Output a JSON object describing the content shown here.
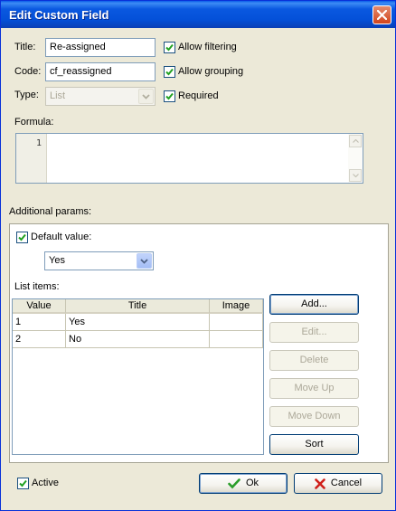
{
  "window": {
    "title": "Edit Custom Field"
  },
  "form": {
    "title_label": "Title:",
    "title_value": "Re-assigned",
    "code_label": "Code:",
    "code_value": "cf_reassigned",
    "type_label": "Type:",
    "type_value": "List",
    "allow_filtering_label": "Allow filtering",
    "allow_filtering_checked": true,
    "allow_grouping_label": "Allow grouping",
    "allow_grouping_checked": true,
    "required_label": "Required",
    "required_checked": true,
    "formula_label": "Formula:",
    "formula_line_number": "1"
  },
  "params": {
    "label": "Additional params:",
    "default_value_label": "Default value:",
    "default_value_checked": true,
    "default_value_selected": "Yes",
    "list_items_label": "List items:",
    "columns": [
      "Value",
      "Title",
      "Image"
    ],
    "rows": [
      {
        "value": "1",
        "title": "Yes",
        "image": ""
      },
      {
        "value": "2",
        "title": "No",
        "image": ""
      }
    ],
    "buttons": {
      "add": "Add...",
      "edit": "Edit...",
      "delete": "Delete",
      "move_up": "Move Up",
      "move_down": "Move Down",
      "sort": "Sort"
    }
  },
  "footer": {
    "active_label": "Active",
    "active_checked": true,
    "ok_label": "Ok",
    "cancel_label": "Cancel"
  },
  "icons": {
    "close": "close-icon",
    "check": "checkmark-icon",
    "dropdown": "chevron-down-icon",
    "ok": "green-check-icon",
    "cancel": "red-x-icon"
  },
  "colors": {
    "titlebar": "#0a58e0",
    "dialog_bg": "#ece9d8",
    "ok_icon": "#2a9d2a",
    "cancel_icon": "#d0201a"
  }
}
